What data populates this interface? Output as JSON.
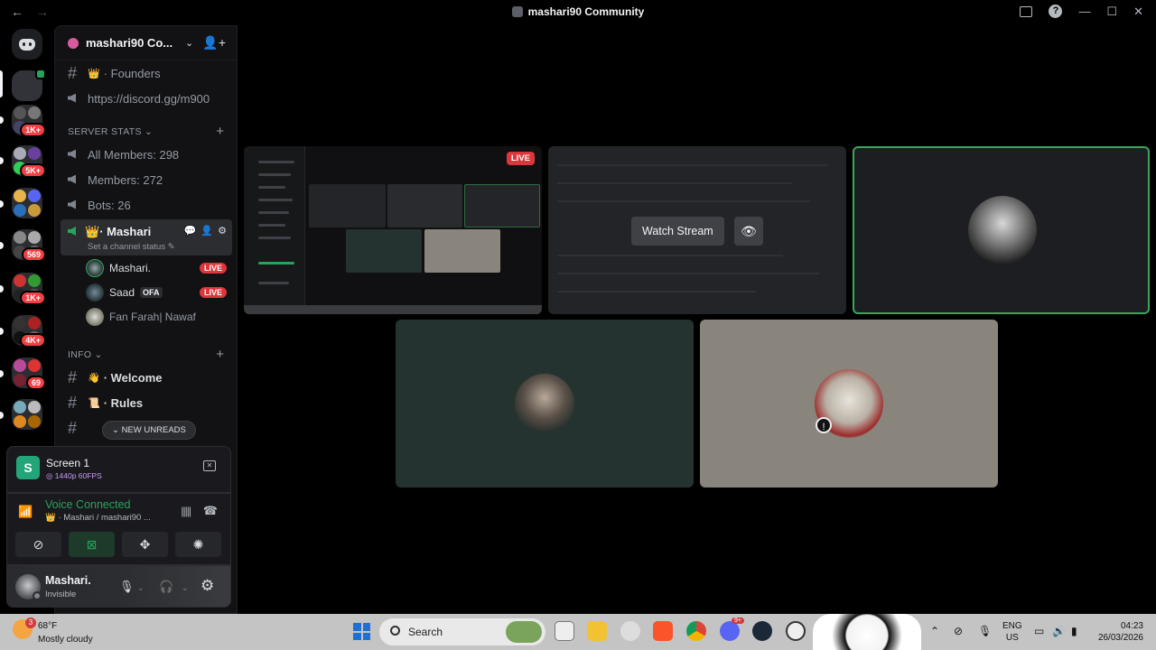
{
  "window": {
    "title": "mashari90 Community",
    "back": "←",
    "forward": "→"
  },
  "server": {
    "name": "mashari90 Co...",
    "chevron": "⌄",
    "invite_icon": "person-add-icon"
  },
  "rail": {
    "badges": [
      "1K+",
      "5K+",
      "569",
      "1K+",
      "4K+",
      "69"
    ]
  },
  "channels": {
    "founders": "· Founders",
    "invite_link": "https://discord.gg/m900",
    "server_stats_cat": "SERVER STATS",
    "all_members": "All Members: 298",
    "members": "Members: 272",
    "bots": "Bots: 26",
    "voice_channel": "· Mashari",
    "voice_status": "Set a channel status",
    "info_cat": "INFO",
    "welcome": "· Welcome",
    "rules": "· Rules",
    "new_unreads": "NEW UNREADS"
  },
  "voice_users": [
    {
      "name": "Mashari.",
      "live": "LIVE",
      "tag": ""
    },
    {
      "name": "Saad",
      "live": "LIVE",
      "tag": "OFA"
    },
    {
      "name": "Fan Farah| Nawaf",
      "live": "",
      "tag": ""
    }
  ],
  "screen_panel": {
    "title": "Screen 1",
    "quality": "1440p 60FPS",
    "thumb_letter": "S"
  },
  "voice_panel": {
    "status": "Voice Connected",
    "location": "· Mashari / mashari90 ..."
  },
  "user_panel": {
    "name": "Mashari.",
    "status": "Invisible"
  },
  "stage": {
    "live_badge": "LIVE",
    "watch_stream": "Watch Stream"
  },
  "taskbar": {
    "weather_badge": "3",
    "temperature": "68°F",
    "condition": "Mostly cloudy",
    "search": "Search",
    "discord_badge": "9+",
    "lang_top": "ENG",
    "lang_bottom": "US",
    "time": "04:23",
    "date": "26/03/2026"
  },
  "colors": {
    "live": "#da373c",
    "connected": "#23a55a",
    "speaking_border": "#3ba55c"
  }
}
